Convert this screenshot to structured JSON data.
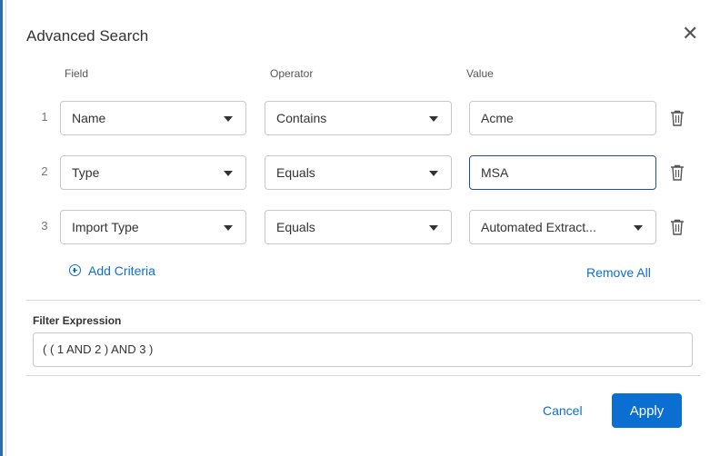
{
  "dialog": {
    "title": "Advanced Search",
    "close_icon": "close-icon"
  },
  "columns": {
    "field": "Field",
    "operator": "Operator",
    "value": "Value"
  },
  "criteria": [
    {
      "num": "1",
      "field": "Name",
      "operator": "Contains",
      "value": "Acme"
    },
    {
      "num": "2",
      "field": "Type",
      "operator": "Equals",
      "value": "MSA"
    },
    {
      "num": "3",
      "field": "Import Type",
      "operator": "Equals",
      "value": "Automated Extract..."
    }
  ],
  "actions": {
    "add_criteria": "Add Criteria",
    "remove_all": "Remove All"
  },
  "filter": {
    "label": "Filter Expression",
    "value": "( ( 1 AND 2 ) AND 3 )"
  },
  "footer": {
    "cancel": "Cancel",
    "apply": "Apply"
  },
  "colors": {
    "accent": "#0b6fd1",
    "focus_border": "#1f4e9c"
  }
}
